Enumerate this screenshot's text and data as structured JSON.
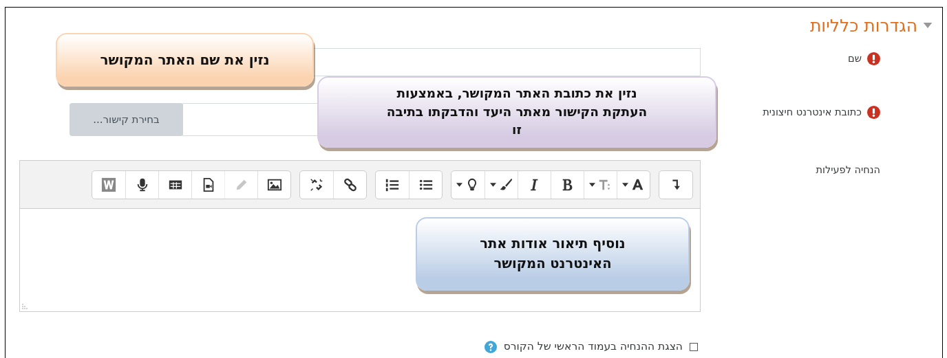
{
  "section": {
    "title": "הגדרות כלליות",
    "expanded": true
  },
  "fields": [
    {
      "kind": "text",
      "label": "שם",
      "required": true
    },
    {
      "kind": "url",
      "label": "כתובת אינטרנט חיצונית",
      "required": true,
      "button": "בחירת קישור..."
    },
    {
      "kind": "editor",
      "label": "הנחיה לפעילות",
      "required": false
    }
  ],
  "toolbar": {
    "groups": [
      [
        {
          "kind": "collapse",
          "dropdown": false,
          "disabled": false
        }
      ],
      [
        {
          "kind": "font",
          "dropdown": true,
          "disabled": false
        },
        {
          "kind": "fontsize",
          "dropdown": true,
          "disabled": false
        },
        {
          "kind": "bold",
          "dropdown": false,
          "disabled": false
        },
        {
          "kind": "italic",
          "dropdown": false,
          "disabled": false
        },
        {
          "kind": "brush",
          "dropdown": true,
          "disabled": false
        },
        {
          "kind": "bulb",
          "dropdown": true,
          "disabled": false
        }
      ],
      [
        {
          "kind": "bullets",
          "dropdown": false,
          "disabled": false
        },
        {
          "kind": "numbers",
          "dropdown": false,
          "disabled": false
        }
      ],
      [
        {
          "kind": "link",
          "dropdown": false,
          "disabled": false
        },
        {
          "kind": "unlink",
          "dropdown": false,
          "disabled": false
        }
      ],
      [
        {
          "kind": "image",
          "dropdown": false,
          "disabled": false
        },
        {
          "kind": "pencil",
          "dropdown": false,
          "disabled": true
        },
        {
          "kind": "media",
          "dropdown": false,
          "disabled": false
        },
        {
          "kind": "table",
          "dropdown": false,
          "disabled": false
        },
        {
          "kind": "mic",
          "dropdown": false,
          "disabled": false
        },
        {
          "kind": "word",
          "dropdown": false,
          "disabled": false
        }
      ]
    ]
  },
  "checkbox": {
    "label": "הצגת ההנחיה בעמוד הראשי של הקורס",
    "checked": false,
    "help": true
  },
  "callouts": [
    {
      "text": "נזין את שם האתר המקושר",
      "color": "#fbd3b0"
    },
    {
      "text": "נזין את כתובת האתר המקושר, באמצעות העתקת הקישור מאתר היעד והדבקתו בתיבה זו",
      "color": "#d6cbe3"
    },
    {
      "text": "נוסיף תיאור אודות אתר האינטרנט המקושר",
      "color": "#b9cde6"
    }
  ]
}
